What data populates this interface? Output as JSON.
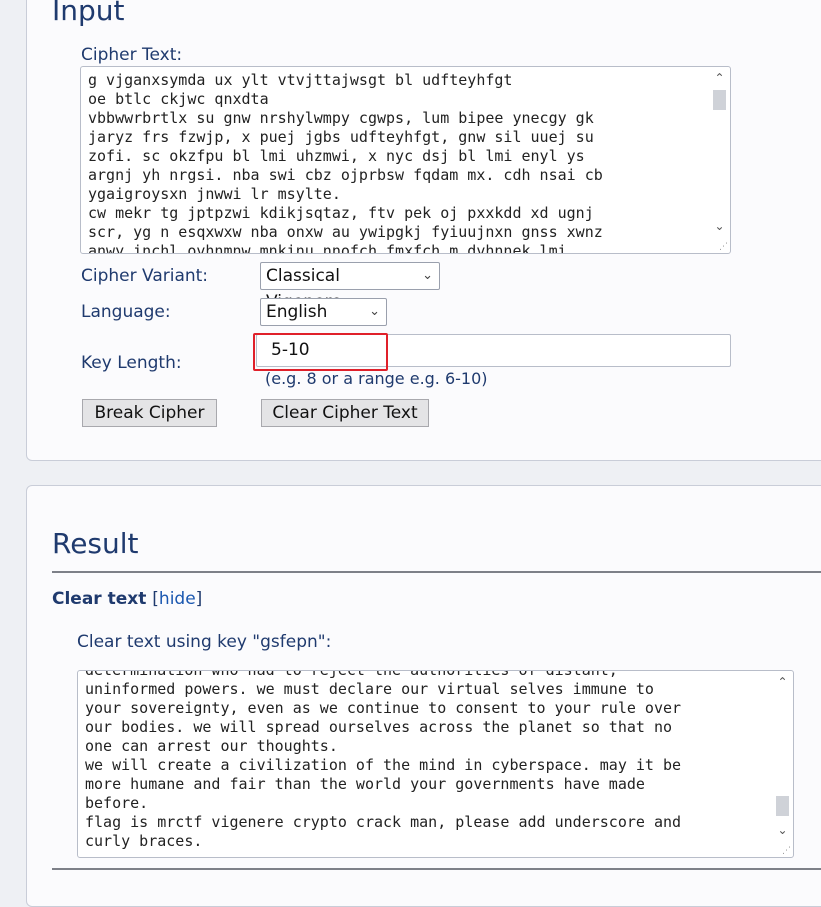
{
  "input_section": {
    "title": "Input",
    "cipher_text_label": "Cipher Text:",
    "cipher_text": "g vjganxsymda ux ylt vtvjttajwsgt bl udfteyhfgt\noe btlc ckjwc qnxdta\nvbbwwrbrtlx su gnw nrshylwmpy cgwps, lum bipee ynecgy gk\njaryz frs fzwjp, x puej jgbs udfteyhfgt, gnw sil uuej su\nzofi. sc okzfpu bl lmi uhzmwi, x nyc dsj bl lmi enyl ys\nargnj yh nrgsi. nba swi cbz ojprbsw fqdam mx. cdh nsai cb\nygaigroysxn jnwwi lr msylte.\ncw mekr tg jptpzwi kdikjsqtaz, ftv pek oj pxxkdd xd ugnj\nscr, yg n esqxwxw nba onxw au ywipgkj fyiuujnxn gnss xwnz\nanwy inchl ovhnmnw mnkinu nnofch fmxfch m dvhnnek lmi",
    "cipher_variant_label": "Cipher Variant:",
    "cipher_variant_value": "Classical Vigenere",
    "language_label": "Language:",
    "language_value": "English",
    "key_length_label": "Key Length:",
    "key_length_value": "5-10",
    "key_length_hint": "(e.g. 8 or a range e.g. 6-10)",
    "break_button": "Break Cipher",
    "clear_button": "Clear Cipher Text"
  },
  "result_section": {
    "title": "Result",
    "clear_text_label": "Clear text",
    "hide_bracket_open": "[",
    "hide_link": "hide",
    "hide_bracket_close": "]",
    "key_line": "Clear text using key \"gsfepn\":",
    "clear_text": "determination who had to reject the authorities of distant,\nuninformed powers. we must declare our virtual selves immune to\nyour sovereignty, even as we continue to consent to your rule over\nour bodies. we will spread ourselves across the planet so that no\none can arrest our thoughts.\nwe will create a civilization of the mind in cyberspace. may it be\nmore humane and fair than the world your governments have made\nbefore.\nflag is mrctf vigenere crypto crack man, please add underscore and\ncurly braces."
  },
  "icons": {
    "scroll_up": "▲",
    "scroll_down": "▼",
    "chevron": "⌵",
    "resize_grip": "⋰"
  }
}
